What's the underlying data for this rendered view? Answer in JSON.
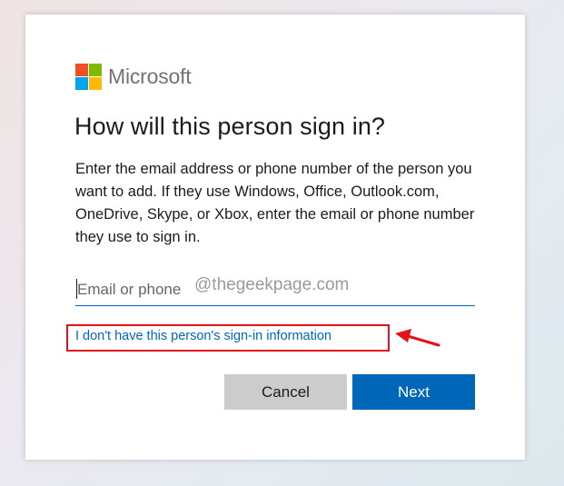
{
  "colors": {
    "accent": "#0067b8",
    "logo_red": "#f25022",
    "logo_green": "#7fba00",
    "logo_blue": "#00a4ef",
    "logo_yellow": "#ffb900",
    "annotation_red": "#e4121a"
  },
  "brand": {
    "name": "Microsoft"
  },
  "dialog": {
    "title": "How will this person sign in?",
    "description": "Enter the email address or phone number of the person you want to add. If they use Windows, Office, Outlook.com, OneDrive, Skype, or Xbox, enter the email or phone number they use to sign in."
  },
  "email_field": {
    "placeholder": "Email or phone",
    "value": ""
  },
  "watermark": "@thegeekpage.com",
  "no_info_link": "I don't have this person's sign-in information",
  "buttons": {
    "cancel": "Cancel",
    "next": "Next"
  }
}
